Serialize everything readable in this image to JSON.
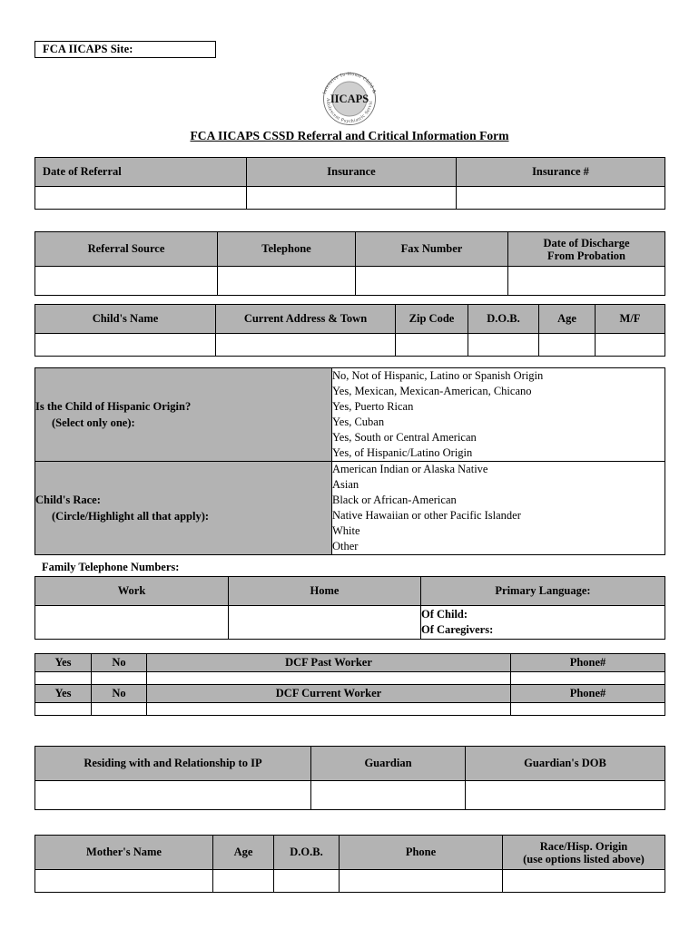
{
  "document": {
    "site_box_label": "FCA IICAPS Site:",
    "title": "FCA IICAPS CSSD Referral and Critical Information Form",
    "logo": {
      "center_text": "IICAPS",
      "arc_top": "Intensive In-Home Child &",
      "arc_bottom": "Adolescent Psychiatric Service"
    },
    "colors": {
      "header_fill": "#b3b3b3",
      "cell_fill": "#ffffff",
      "border": "#000000",
      "text": "#000000"
    }
  },
  "referral_table": {
    "headers": [
      "Date of Referral",
      "Insurance",
      "Insurance #"
    ],
    "values": [
      "",
      "",
      ""
    ]
  },
  "source_table": {
    "headers": [
      "Referral Source",
      "Telephone",
      "Fax Number"
    ],
    "discharge_header": {
      "line1": "Date of Discharge",
      "line2": "From Probation"
    },
    "values": [
      "",
      "",
      "",
      ""
    ]
  },
  "child_table": {
    "headers": [
      "Child's Name",
      "Current Address & Town",
      "Zip Code",
      "D.O.B.",
      "Age",
      "M/F"
    ],
    "values": [
      "",
      "",
      "",
      "",
      "",
      ""
    ]
  },
  "ethnicity": {
    "hispanic": {
      "label_line1": "Is the Child of Hispanic Origin?",
      "label_line2": "(Select only one):",
      "options": [
        "No, Not of Hispanic, Latino or Spanish Origin",
        "Yes, Mexican, Mexican-American, Chicano",
        "Yes, Puerto Rican",
        "Yes, Cuban",
        "Yes, South or Central American",
        "Yes, of Hispanic/Latino Origin"
      ]
    },
    "race": {
      "label_line1": "Child's Race:",
      "label_line2": "(Circle/Highlight all that apply):",
      "options": [
        "American Indian or Alaska Native",
        "Asian",
        "Black or African-American",
        "Native Hawaiian or other Pacific Islander",
        "White",
        "Other"
      ]
    }
  },
  "family_phone": {
    "caption": "Family Telephone Numbers:",
    "headers": [
      "Work",
      "Home",
      "Primary Language:"
    ],
    "language_rows": [
      "Of Child:",
      "Of Caregivers:"
    ],
    "values": [
      "",
      ""
    ]
  },
  "dcf": {
    "rows": [
      {
        "yes": "Yes",
        "no": "No",
        "title": "DCF Past Worker",
        "phone": "Phone#"
      },
      {
        "yes": "Yes",
        "no": "No",
        "title": "DCF Current Worker",
        "phone": "Phone#"
      }
    ],
    "values": [
      "",
      "",
      "",
      "",
      "",
      "",
      "",
      ""
    ]
  },
  "residing_table": {
    "headers": [
      "Residing with and Relationship to IP",
      "Guardian",
      "Guardian's DOB"
    ],
    "values": [
      "",
      "",
      ""
    ]
  },
  "mother_table": {
    "headers": [
      "Mother's Name",
      "Age",
      "D.O.B.",
      "Phone"
    ],
    "race_header": {
      "line1": "Race/Hisp. Origin",
      "line2": "(use options listed above)"
    },
    "values": [
      "",
      "",
      "",
      "",
      ""
    ]
  }
}
